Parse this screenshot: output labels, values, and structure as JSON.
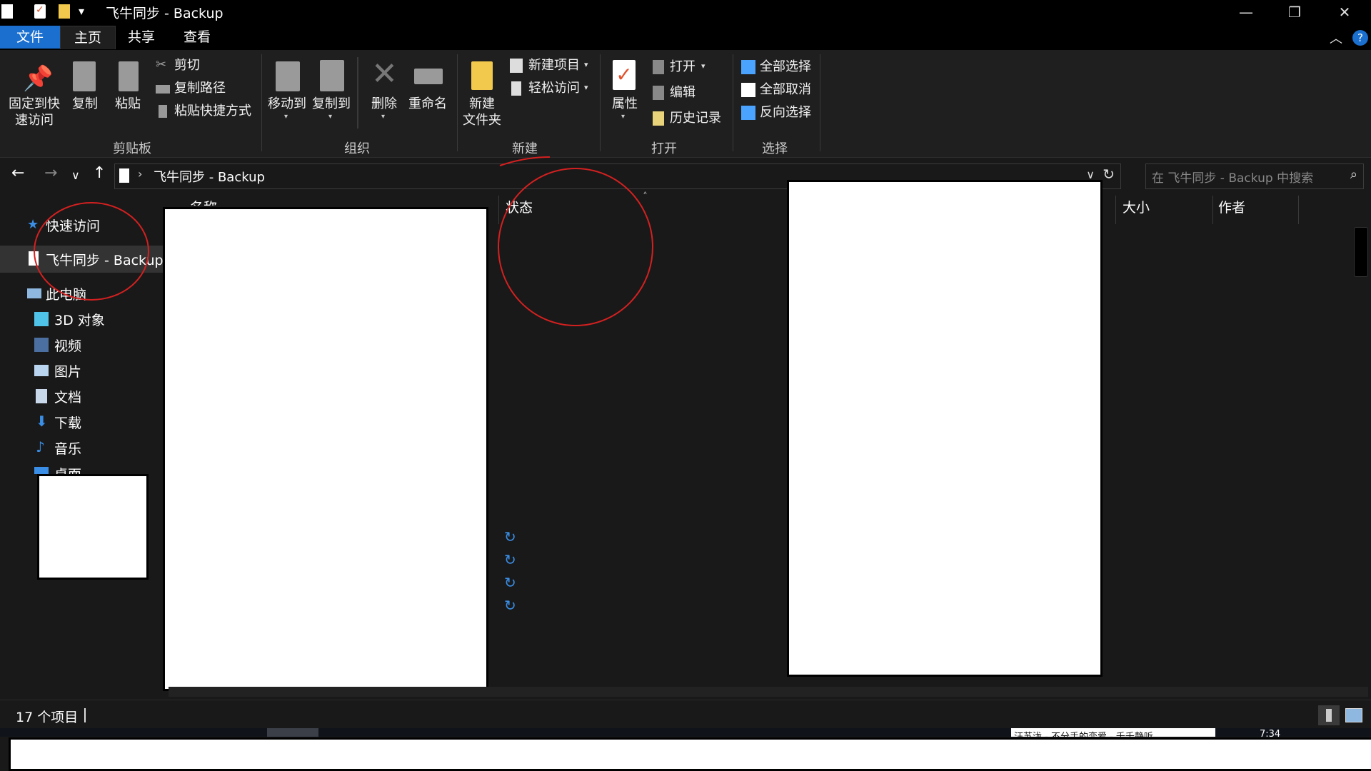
{
  "window": {
    "title": "飞牛同步 - Backup",
    "controls": {
      "minimize": "—",
      "maximize": "❐",
      "close": "✕"
    }
  },
  "tabs": [
    {
      "label": "文件"
    },
    {
      "label": "主页"
    },
    {
      "label": "共享"
    },
    {
      "label": "查看"
    }
  ],
  "ribbon": {
    "clipboard": {
      "group_label": "剪贴板",
      "pin_line1": "固定到快",
      "pin_line2": "速访问",
      "copy": "复制",
      "paste": "粘贴",
      "cut": "剪切",
      "copy_path": "复制路径",
      "paste_shortcut": "粘贴快捷方式"
    },
    "organize": {
      "group_label": "组织",
      "move_to": "移动到",
      "copy_to": "复制到",
      "delete": "删除",
      "rename": "重命名"
    },
    "new": {
      "group_label": "新建",
      "new_folder_line1": "新建",
      "new_folder_line2": "文件夹",
      "new_item": "新建项目",
      "easy_access": "轻松访问"
    },
    "open": {
      "group_label": "打开",
      "properties": "属性",
      "open": "打开",
      "edit": "编辑",
      "history": "历史记录"
    },
    "select": {
      "group_label": "选择",
      "select_all": "全部选择",
      "select_none": "全部取消",
      "invert": "反向选择"
    }
  },
  "address": {
    "path": "飞牛同步 - Backup",
    "search_placeholder": "在 飞牛同步 - Backup 中搜索"
  },
  "nav": {
    "quick_access": "快速访问",
    "sync_folder": "飞牛同步 - Backup",
    "this_pc": "此电脑",
    "objects3d": "3D 对象",
    "videos": "视频",
    "pictures": "图片",
    "documents": "文档",
    "downloads": "下载",
    "music": "音乐",
    "desktop_partial": "桌面"
  },
  "columns": {
    "name_partial": "名称",
    "status": "状态",
    "size": "大小",
    "author": "作者"
  },
  "status": {
    "item_count": "17 个项目"
  },
  "taskbar": {
    "song_partial": "汪苏泷 - 不分手的恋爱 - 千千静听",
    "time_partial": "7:34"
  },
  "colors": {
    "accent": "#1a6fcf",
    "annotation": "#d42020",
    "sync_icon": "#3a8ee6"
  }
}
